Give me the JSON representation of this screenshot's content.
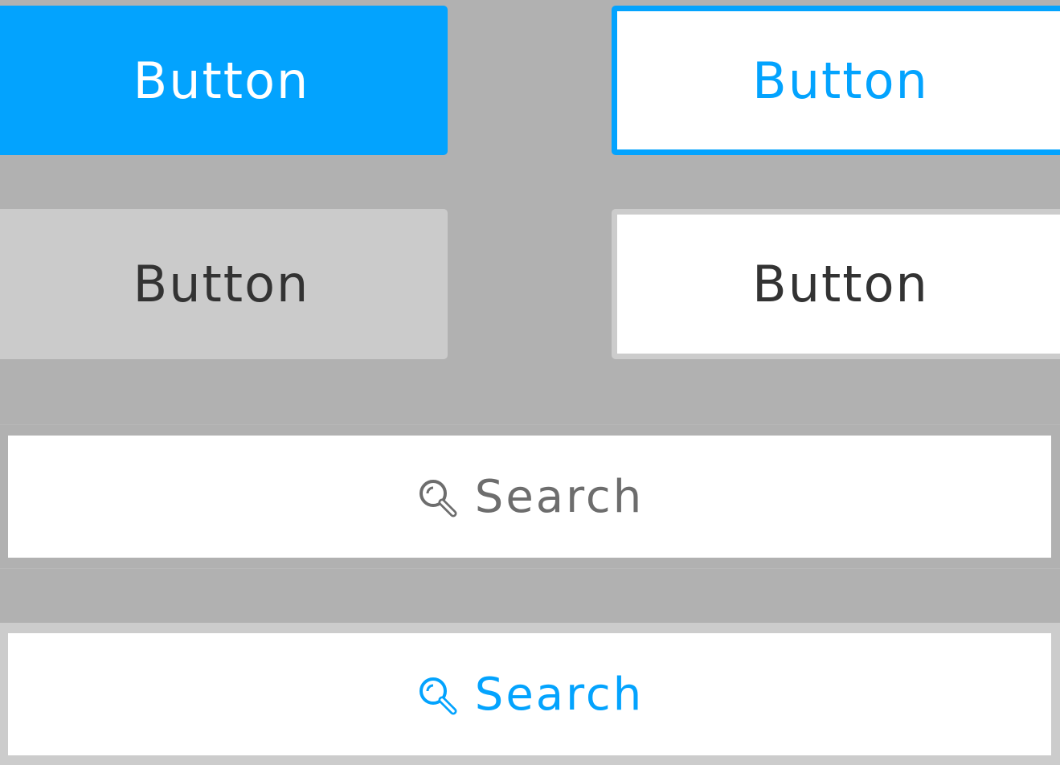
{
  "buttons": {
    "primary_filled": {
      "label": "Button"
    },
    "primary_outline": {
      "label": "Button"
    },
    "secondary_filled": {
      "label": "Button"
    },
    "secondary_outline": {
      "label": "Button"
    }
  },
  "search_bars": [
    {
      "placeholder": "Search",
      "state": "default",
      "color": "#6d6d6d"
    },
    {
      "placeholder": "Search",
      "state": "active",
      "color": "#03a3fe"
    }
  ],
  "colors": {
    "accent": "#03a3fe",
    "background": "#b1b1b1",
    "secondary_fill": "#cbcbcb",
    "text_dark": "#333333",
    "text_muted": "#6d6d6d"
  },
  "icons": {
    "search": "magnifier-icon"
  }
}
